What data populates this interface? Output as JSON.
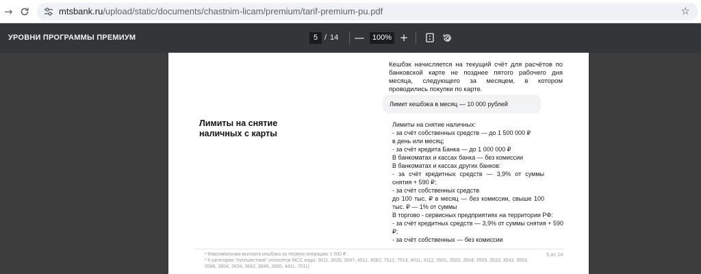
{
  "browser": {
    "url_domain": "mtsbank.ru",
    "url_path": "/upload/static/documents/chastnim-licam/premium/tarif-premium-pu.pdf",
    "back_icon": "arrow-right-icon",
    "reload_icon": "reload-icon",
    "site_info_icon": "tune-icon",
    "bookmark_icon": "star-icon"
  },
  "pdf_toolbar": {
    "title": "УРОВНИ ПРОГРАММЫ ПРЕМИУМ",
    "current_page": "5",
    "separator": "/",
    "total_pages": "14",
    "zoom_out_label": "—",
    "zoom": "100%",
    "zoom_in_label": "+",
    "fit_icon": "fit-page-icon",
    "rotate_icon": "rotate-icon"
  },
  "page": {
    "cashback_note": "Кешбэк начисляется на текущий счёт для расчётов по банковской карте не позднее пятого рабочего дня месяца, следующего за месяцем, в котором проводились покупки по карте.",
    "cashback_limit": "Лимит кешбэка в месяц — 10 000 рублей",
    "section_title": "Лимиты на снятие наличных с карты",
    "limits": {
      "l1": "Лимиты на снятие наличных:",
      "l2": "- за счёт собственных средств — до 1 500 000 ₽",
      "l3": "в день или  месяц;",
      "l4": "-    за счёт кредита Банка — до 1 000 000 ₽",
      "l5": "В банкоматах и кассах банка — без комиссии",
      "l6": "В банкоматах и кассах других банков:",
      "l7": "-    за счёт кредитных средств — 3,9% от суммы снятия + 590 ₽;",
      "l8": "-    за счёт собственных средств",
      "l9": "до 100 тыс. ₽ в месяц — без комиссии, свыше 100 тыс. ₽ — 1%   от суммы",
      "l10": "В торгово - сервисных предприятиях на территории РФ:",
      "l11": "   -    за счёт кредитных средств — 3,9% от суммы снятия + 590 ₽;",
      "l12": " - за счёт собственных  — без комиссии"
    },
    "footnote1": "¹ Максимальная выплата кешбэка за первую операцию 1 000 ₽.",
    "footnote2": "² К категории \"путешествия\" относятся MCC коды: 3011, 3026, 3047, 4511, 4582, 7512, 7513, 4011, 4112, 3501, 3503, 3504, 3509, 3533, 3543, 3553, 3586, 3604, 3634, 3642, 3649, 3665, 4411, 7011)",
    "page_number": "5 из 14"
  }
}
